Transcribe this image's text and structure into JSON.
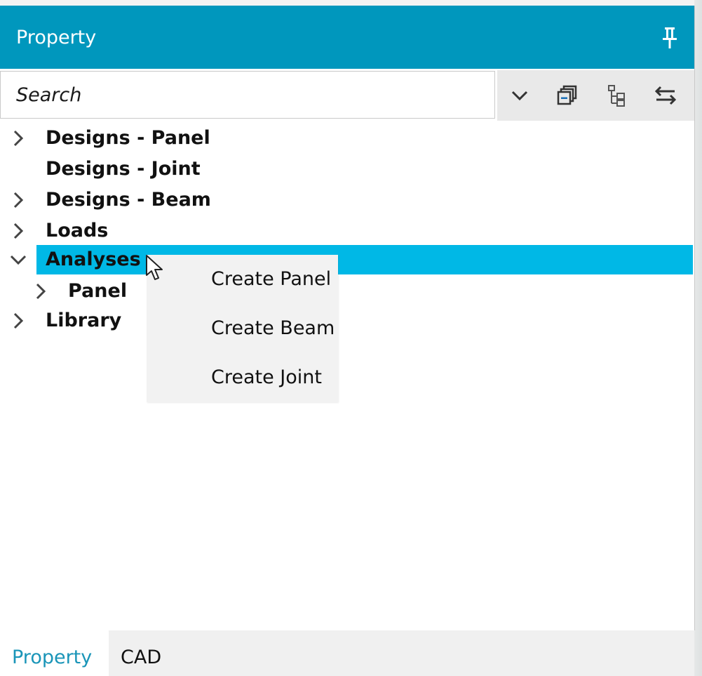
{
  "panel": {
    "title": "Property"
  },
  "toolbar": {
    "search_placeholder": "Search",
    "buttons": [
      "chevron-down-icon",
      "collapse-all-icon",
      "tree-structure-icon",
      "swap-arrows-icon"
    ]
  },
  "tree": {
    "items": [
      {
        "label": "Designs - Panel",
        "expandable": true,
        "expanded": false,
        "level": 0
      },
      {
        "label": "Designs - Joint",
        "expandable": false,
        "expanded": false,
        "level": 0
      },
      {
        "label": "Designs - Beam",
        "expandable": true,
        "expanded": false,
        "level": 0
      },
      {
        "label": "Loads",
        "expandable": true,
        "expanded": false,
        "level": 0
      },
      {
        "label": "Analyses",
        "expandable": true,
        "expanded": true,
        "level": 0,
        "selected": true
      },
      {
        "label": "Panel",
        "expandable": true,
        "expanded": false,
        "level": 1
      },
      {
        "label": "Library",
        "expandable": true,
        "expanded": false,
        "level": 0
      }
    ]
  },
  "context_menu": {
    "items": [
      {
        "label": "Create Panel"
      },
      {
        "label": "Create Beam"
      },
      {
        "label": "Create Joint"
      }
    ]
  },
  "tabs": [
    {
      "label": "Property",
      "active": true
    },
    {
      "label": "CAD",
      "active": false
    }
  ],
  "colors": {
    "titlebar": "#0097bd",
    "selection": "#00b8e6",
    "active_tab_text": "#1a95b8"
  }
}
